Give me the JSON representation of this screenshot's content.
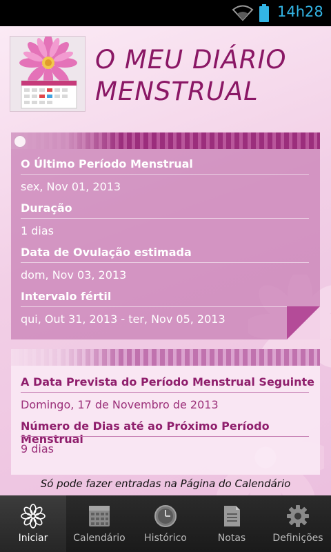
{
  "status_bar": {
    "time": "14h28",
    "wifi_icon": "wifi-icon",
    "battery_icon": "battery-icon"
  },
  "header": {
    "title_line1": "O MEU DIÁRIO",
    "title_line2": "MENSTRUAL",
    "logo_icon": "flower-calendar-logo"
  },
  "card_summary": {
    "rows": [
      {
        "label": "O Último Período Menstrual",
        "value": "sex, Nov 01, 2013"
      },
      {
        "label": "Duração",
        "value": "1 dias"
      },
      {
        "label": "Data de Ovulação estimada",
        "value": "dom, Nov 03, 2013"
      },
      {
        "label": "Intervalo fértil",
        "value": "qui, Out 31, 2013 - ter, Nov 05, 2013"
      }
    ]
  },
  "card_forecast": {
    "rows": [
      {
        "label": "A Data Prevista do Período Menstrual Seguinte",
        "value": "Domingo, 17 de Novembro de 2013"
      },
      {
        "label": "Número de Dias até ao Próximo Período Menstrual",
        "value": "9 dias"
      }
    ]
  },
  "info_note": "Só pode fazer entradas na Página do Calendário",
  "bottom_nav": {
    "items": [
      {
        "label": "Iniciar",
        "icon": "flower-icon",
        "active": true
      },
      {
        "label": "Calendário",
        "icon": "calendar-icon",
        "active": false
      },
      {
        "label": "Histórico",
        "icon": "clock-icon",
        "active": false
      },
      {
        "label": "Notas",
        "icon": "notes-icon",
        "active": false
      },
      {
        "label": "Definições",
        "icon": "gear-icon",
        "active": false
      }
    ]
  },
  "colors": {
    "accent": "#8a1765",
    "status_time": "#33b5e5",
    "card_purple": "#c880b6"
  }
}
